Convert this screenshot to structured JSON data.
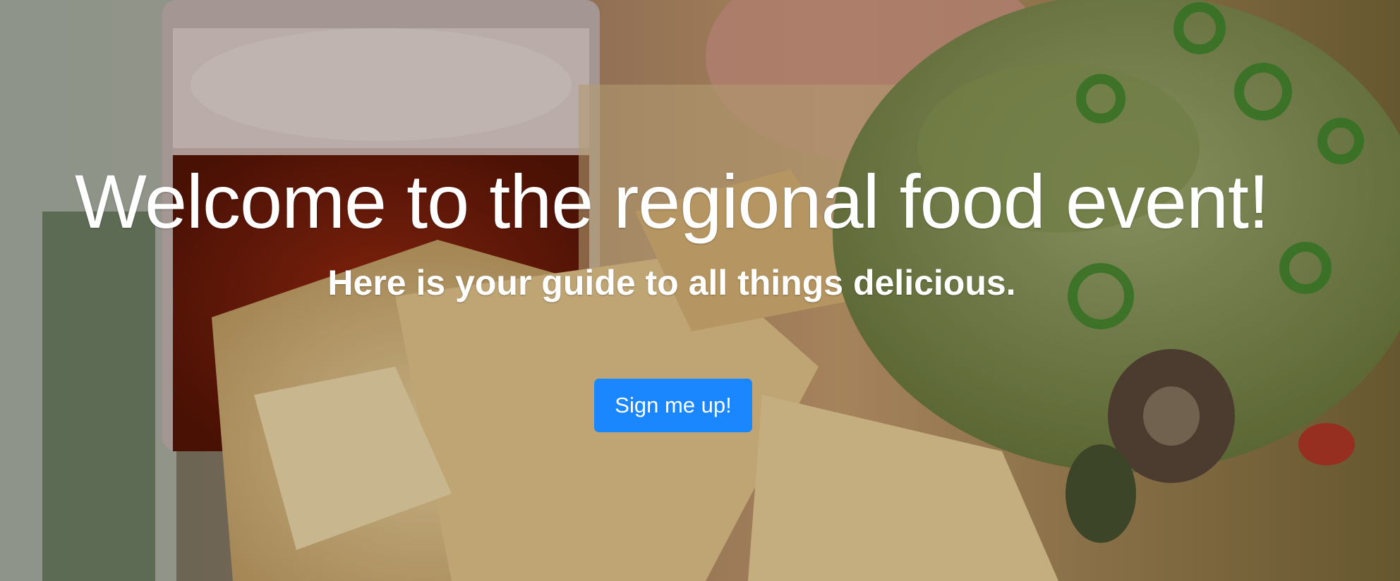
{
  "hero": {
    "headline": "Welcome to the regional food event!",
    "subheadline": "Here is your guide to all things delicious.",
    "cta_label": "Sign me up!"
  },
  "colors": {
    "button_bg": "#1a86ff",
    "text": "#ffffff"
  }
}
